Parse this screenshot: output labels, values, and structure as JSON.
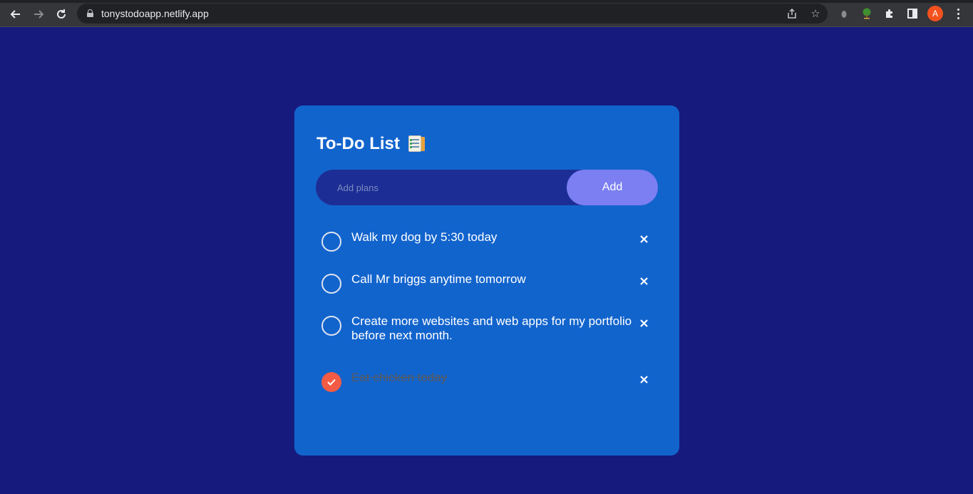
{
  "browser": {
    "url": "tonystodoapp.netlify.app",
    "avatar_letter": "A",
    "icons": [
      "back-icon",
      "forward-icon",
      "reload-icon",
      "lock-icon",
      "share-icon",
      "star-icon",
      "extension-icon",
      "tree-extension-icon",
      "puzzle-icon",
      "side-panel-icon",
      "menu-icon"
    ]
  },
  "app": {
    "title": "To-Do List",
    "title_icon": "notepad-icon",
    "input_placeholder": "Add plans",
    "add_label": "Add",
    "todos": [
      {
        "text": "Walk my dog by 5:30 today",
        "done": false
      },
      {
        "text": "Call Mr briggs anytime tomorrow",
        "done": false
      },
      {
        "text": "Create more websites and web apps for my portfolio before next month.",
        "done": false
      },
      {
        "text": "Eat chicken today",
        "done": true
      }
    ]
  },
  "colors": {
    "page_bg": "#161a7c",
    "card_bg": "#1264cd",
    "input_bg": "#1c2e95",
    "button_bg": "#7b7ff2",
    "done_check": "#f35b44"
  }
}
